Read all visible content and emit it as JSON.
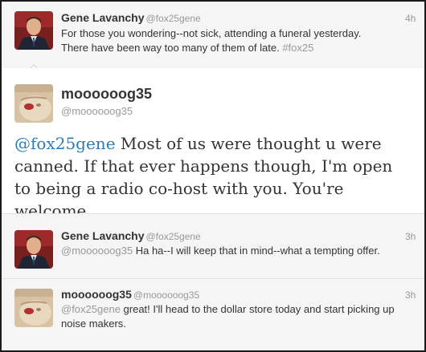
{
  "conversation": {
    "tweet_1": {
      "display_name": "Gene Lavanchy",
      "handle": "@fox25gene",
      "time": "4h",
      "text_line_1": "For those you wondering--not sick, attending a funeral yesterday.",
      "text_line_2_prefix": "There have been way too many of them of late. ",
      "hashtag": "#fox25"
    },
    "focused_tweet": {
      "display_name": "moooooog35",
      "handle": "@moooooog35",
      "mention": "@fox25gene",
      "text": " Most of us were thought u were canned. If that ever happens though, I'm open to being a radio co-host with you. You're welcome."
    },
    "reply_1": {
      "display_name": "Gene Lavanchy",
      "handle": "@fox25gene",
      "time": "3h",
      "mention": "@moooooog35",
      "text": " Ha ha--I will keep that in mind--what a tempting offer."
    },
    "reply_2": {
      "display_name": "moooooog35",
      "handle": "@moooooog35",
      "time": "3h",
      "mention": "@fox25gene",
      "text": " great! I'll head to the dollar store today and start picking up noise makers."
    }
  },
  "colors": {
    "background_dim": "#f5f5f5",
    "focused_background": "#ffffff",
    "link_blue": "#2b7bb9",
    "muted_text": "#999999",
    "body_text": "#333333"
  },
  "icons": {
    "avatar_gene": "man-in-suit-avatar",
    "avatar_mog": "cat-face-avatar",
    "conversation_caret": "caret-up-icon"
  }
}
